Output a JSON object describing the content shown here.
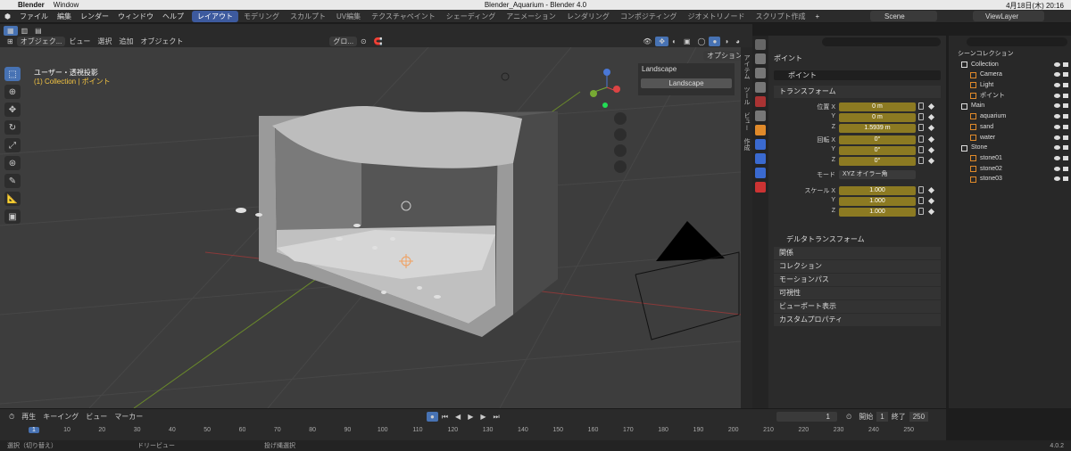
{
  "mac": {
    "app": "Blender",
    "menu": "Window",
    "title": "Blender_Aquarium - Blender 4.0",
    "clock": "4月18日(木) 20:16"
  },
  "topmenu": [
    "ファイル",
    "編集",
    "レンダー",
    "ウィンドウ",
    "ヘルプ"
  ],
  "workspaces": [
    "レイアウト",
    "モデリング",
    "スカルプト",
    "UV編集",
    "テクスチャペイント",
    "シェーディング",
    "アニメーション",
    "レンダリング",
    "コンポジティング",
    "ジオメトリノード",
    "スクリプト作成"
  ],
  "scene": "Scene",
  "viewlayer": "ViewLayer",
  "vpheader": {
    "mode": "オブジェク...",
    "view": "ビュー",
    "select": "選択",
    "add": "追加",
    "object": "オブジェクト",
    "transform": "グロ...",
    "options": "オプション"
  },
  "vpinfo": {
    "line1": "ユーザー・透視投影",
    "line2": "(1) Collection | ポイント"
  },
  "npanel": {
    "header": "Landscape",
    "button": "Landscape"
  },
  "ntabs": [
    "アイテム",
    "ツール",
    "ビュー",
    "作成"
  ],
  "props": {
    "search_placeholder": "",
    "object": "ポイント",
    "object_name": "ポイント",
    "transform": "トランスフォーム",
    "loc_label": "位置 X",
    "y": "Y",
    "z": "Z",
    "loc": [
      "0 m",
      "0 m",
      "1.5939 m"
    ],
    "rot_label": "回転 X",
    "rot": [
      "0°",
      "0°",
      "0°"
    ],
    "mode_label": "モード",
    "mode": "XYZ オイラー角",
    "scale_label": "スケール X",
    "scale": [
      "1.000",
      "1.000",
      "1.000"
    ],
    "delta": "デルタトランスフォーム",
    "sections": [
      "関係",
      "コレクション",
      "モーションパス",
      "可視性",
      "ビューポート表示",
      "カスタムプロパティ"
    ]
  },
  "outliner": {
    "root": "シーンコレクション",
    "rows": [
      {
        "name": "Collection",
        "level": 0,
        "icon": "collection-icon"
      },
      {
        "name": "Camera",
        "level": 1,
        "icon": "camera-icon"
      },
      {
        "name": "Light",
        "level": 1,
        "icon": "light-icon"
      },
      {
        "name": "ポイント",
        "level": 1,
        "icon": "light-icon"
      },
      {
        "name": "Main",
        "level": 0,
        "icon": "collection-icon"
      },
      {
        "name": "aquarium",
        "level": 1,
        "icon": "mesh-icon"
      },
      {
        "name": "sand",
        "level": 1,
        "icon": "mesh-icon"
      },
      {
        "name": "water",
        "level": 1,
        "icon": "mesh-icon"
      },
      {
        "name": "Stone",
        "level": 0,
        "icon": "collection-icon"
      },
      {
        "name": "stone01",
        "level": 1,
        "icon": "mesh-icon"
      },
      {
        "name": "stone02",
        "level": 1,
        "icon": "mesh-icon"
      },
      {
        "name": "stone03",
        "level": 1,
        "icon": "mesh-icon"
      }
    ]
  },
  "timeline": {
    "playback": "再生",
    "keying": "キーイング",
    "view": "ビュー",
    "marker": "マーカー",
    "current": "1",
    "start_label": "開始",
    "start": "1",
    "end_label": "終了",
    "end": "250",
    "playhead": "1",
    "ticks": [
      "10",
      "20",
      "30",
      "40",
      "50",
      "60",
      "70",
      "80",
      "90",
      "100",
      "110",
      "120",
      "130",
      "140",
      "150",
      "160",
      "170",
      "180",
      "190",
      "200",
      "210",
      "220",
      "230",
      "240",
      "250"
    ]
  },
  "status": {
    "select": "選択（切り替え）",
    "dolly": "ドリービュー",
    "lasso": "投げ縄選択",
    "version": "4.0.2"
  },
  "colors": {
    "accent": "#4772b3",
    "field": "#8c7a22",
    "active_text": "#f5c542"
  }
}
